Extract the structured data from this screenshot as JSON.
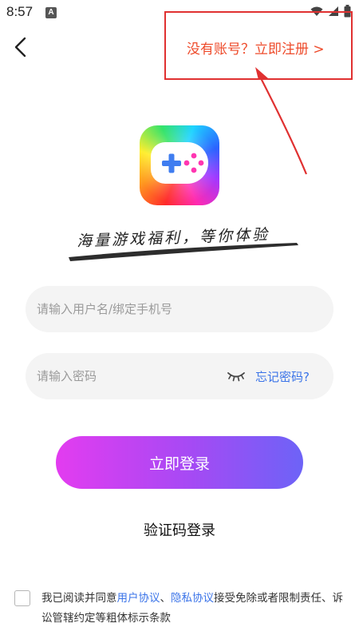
{
  "status_bar": {
    "time": "8:57",
    "notification_badge": "A",
    "icons": [
      "wifi-icon",
      "signal-icon",
      "battery-icon"
    ]
  },
  "header": {
    "back_icon": "chevron-left-icon",
    "register_prompt": "没有账号？立即注册 >"
  },
  "logo": {
    "icon": "gamepad-icon"
  },
  "slogan": "海量游戏福利，等你体验",
  "form": {
    "username_placeholder": "请输入用户名/绑定手机号",
    "password_placeholder": "请输入密码",
    "password_toggle_icon": "eye-closed-icon",
    "forgot_password": "忘记密码?",
    "login_button": "立即登录",
    "code_login": "验证码登录"
  },
  "agreement": {
    "prefix": "我已阅读并同意",
    "user_agreement": "用户协议",
    "separator": "、",
    "privacy_policy": "隐私协议",
    "suffix": "接受免除或者限制责任、诉讼管辖约定等粗体标示条款"
  },
  "colors": {
    "accent_orange": "#ee4b2b",
    "link_blue": "#3a73e8",
    "annotation_red": "#e03131",
    "button_gradient_start": "#e33cf0",
    "button_gradient_end": "#6d63f7"
  }
}
